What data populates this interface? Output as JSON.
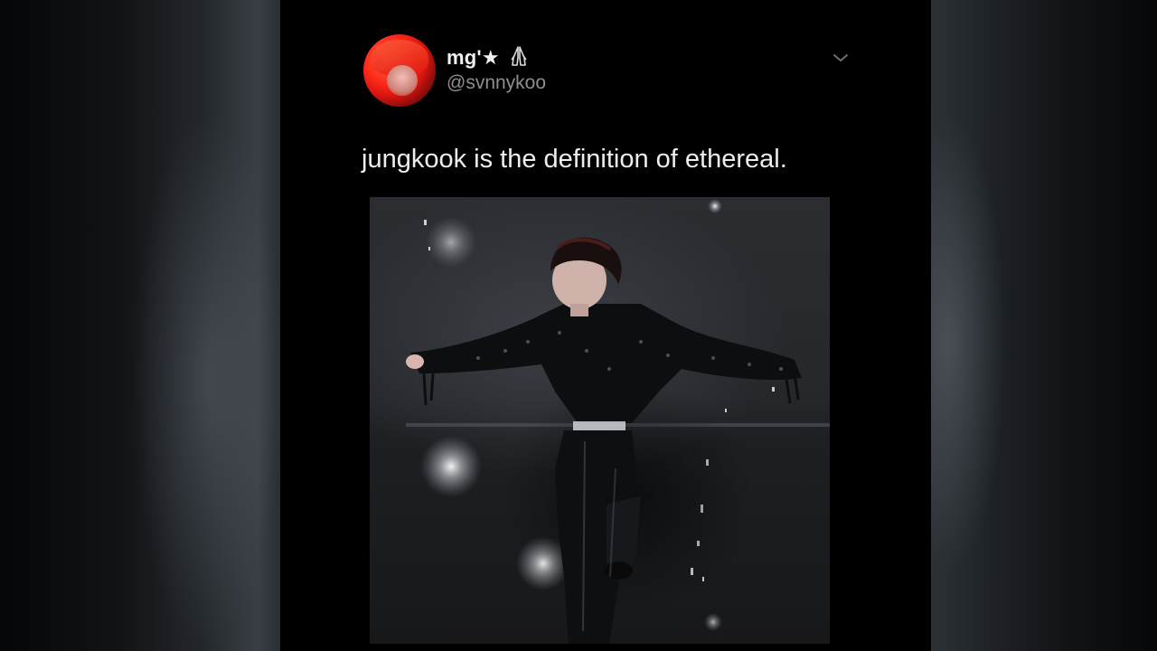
{
  "tweet": {
    "display_name": "mg'★",
    "handle": "@svnnykoo",
    "text": "jungkook is the definition of ethereal."
  },
  "icons": {
    "avatar": "profile-avatar",
    "emoji": "folded-hands-emoji",
    "menu": "chevron-down-icon"
  },
  "colors": {
    "background": "#000000",
    "name_text": "#f2f2f2",
    "handle_text": "#8e8e93",
    "body_text": "#ededed",
    "avatar_accent": "#e0160c"
  }
}
